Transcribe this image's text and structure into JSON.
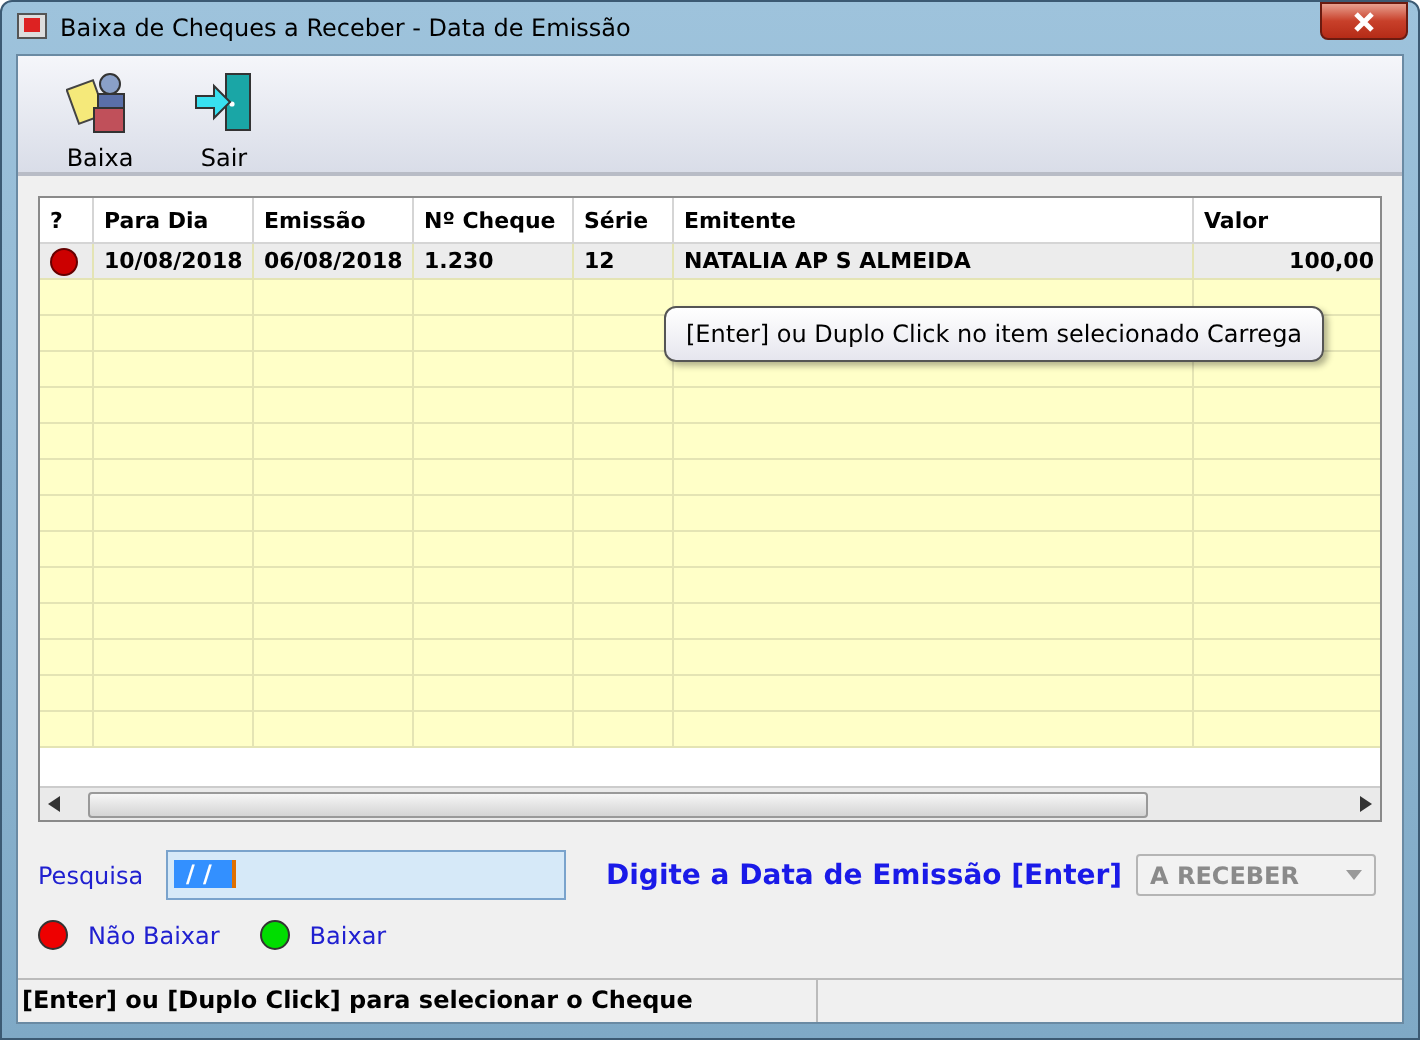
{
  "window": {
    "title": "Baixa de Cheques a Receber - Data de Emissão"
  },
  "toolbar": [
    {
      "label": "Baixa",
      "kind": "baixa"
    },
    {
      "label": "Sair",
      "kind": "sair"
    }
  ],
  "table": {
    "columns": [
      "?",
      "Para Dia",
      "Emissão",
      "Nº Cheque",
      "Série",
      "Emitente",
      "Valor"
    ],
    "rows": [
      {
        "color": "#cc0000",
        "selected": true,
        "cells": [
          "",
          "10/08/2018",
          "06/08/2018",
          "1.230",
          "12",
          "NATALIA AP S ALMEIDA",
          "100,00"
        ]
      }
    ]
  },
  "tooltip": "[Enter] ou Duplo Click no item selecionado Carrega",
  "search": {
    "label": "Pesquisa",
    "value": "/ /"
  },
  "hint": "Digite a Data de Emissão [Enter]",
  "filter": {
    "value": "A RECEBER",
    "disabled": true
  },
  "legend": [
    {
      "label": "Não Baixar",
      "color": "#ee0000"
    },
    {
      "label": "Baixar",
      "color": "#00dd00"
    }
  ],
  "status_bar": "[Enter] ou [Duplo Click] para selecionar o Cheque"
}
